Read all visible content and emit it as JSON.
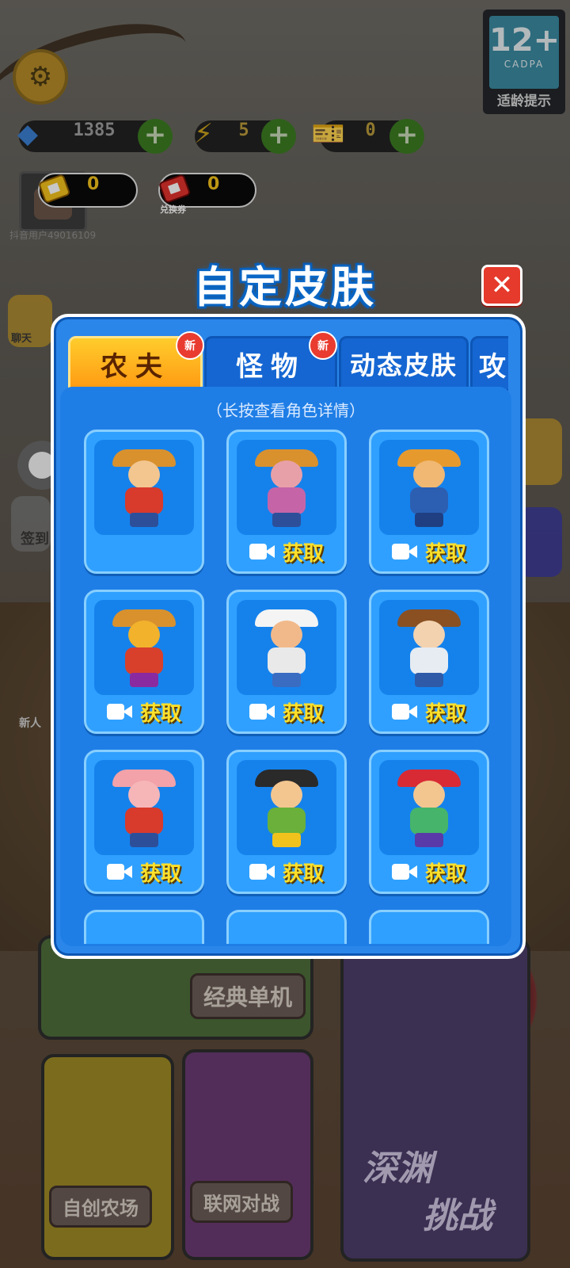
{
  "hud": {
    "gems": "1385",
    "energy": "5",
    "vip_tickets": "0",
    "gold_ticket": "0",
    "exchange_ticket": "0",
    "exchange_label": "兑换券",
    "username": "抖音用户49016109",
    "age_rating": {
      "big": "12+",
      "org": "CADPA",
      "label": "适龄提示"
    }
  },
  "modal": {
    "title": "自定皮肤",
    "hint": "（长按查看角色详情）",
    "tabs": [
      {
        "label": "农夫",
        "badge": "新",
        "active": true
      },
      {
        "label": "怪物",
        "badge": "新",
        "active": false
      },
      {
        "label": "动态皮肤",
        "badge": "",
        "active": false
      },
      {
        "label": "攻",
        "badge": "",
        "active": false
      }
    ],
    "get_label": "获取",
    "skins": [
      {
        "name": "farmer-pitchfork",
        "locked": false,
        "colors": {
          "hat": "#d9912e",
          "head": "#f3c690",
          "body": "#d83a2c",
          "legs": "#2d4f9a"
        }
      },
      {
        "name": "farmer-grandma",
        "locked": true,
        "colors": {
          "hat": "#d9912e",
          "head": "#e8a0a8",
          "body": "#c565a8",
          "legs": "#2d4f9a"
        }
      },
      {
        "name": "farmer-shovel",
        "locked": true,
        "colors": {
          "hat": "#e69a2e",
          "head": "#f1b873",
          "body": "#2c5fb2",
          "legs": "#1f3f82"
        }
      },
      {
        "name": "farmer-leopard",
        "locked": true,
        "colors": {
          "hat": "#d9912e",
          "head": "#f2b22c",
          "body": "#d8402c",
          "legs": "#8a2aa0"
        }
      },
      {
        "name": "farmer-bearded",
        "locked": true,
        "colors": {
          "hat": "#f4f4f4",
          "head": "#f1b98a",
          "body": "#e9e9e9",
          "legs": "#3a6cc2"
        }
      },
      {
        "name": "farmer-glasses",
        "locked": true,
        "colors": {
          "hat": "#8a5022",
          "head": "#f3d2b0",
          "body": "#e6ecf2",
          "legs": "#2e5aa8"
        }
      },
      {
        "name": "farmer-pig",
        "locked": true,
        "colors": {
          "hat": "#f2a2a8",
          "head": "#f6b6b8",
          "body": "#d83a2c",
          "legs": "#2d4f9a"
        }
      },
      {
        "name": "farmer-boy",
        "locked": true,
        "colors": {
          "hat": "#2a2a2a",
          "head": "#f3c690",
          "body": "#6ab03a",
          "legs": "#f2c21c"
        }
      },
      {
        "name": "farmer-helmet",
        "locked": true,
        "colors": {
          "hat": "#d82a34",
          "head": "#f3c690",
          "body": "#46b46a",
          "legs": "#5a3aa8"
        }
      }
    ]
  },
  "menu": {
    "classic": "经典单机",
    "create_farm": "自创农场",
    "online_battle": "联网对战",
    "abyss_1": "深渊",
    "abyss_2": "挑战",
    "side_chat": "聊天",
    "side_sign": "签到",
    "side_newbie": "新人"
  }
}
